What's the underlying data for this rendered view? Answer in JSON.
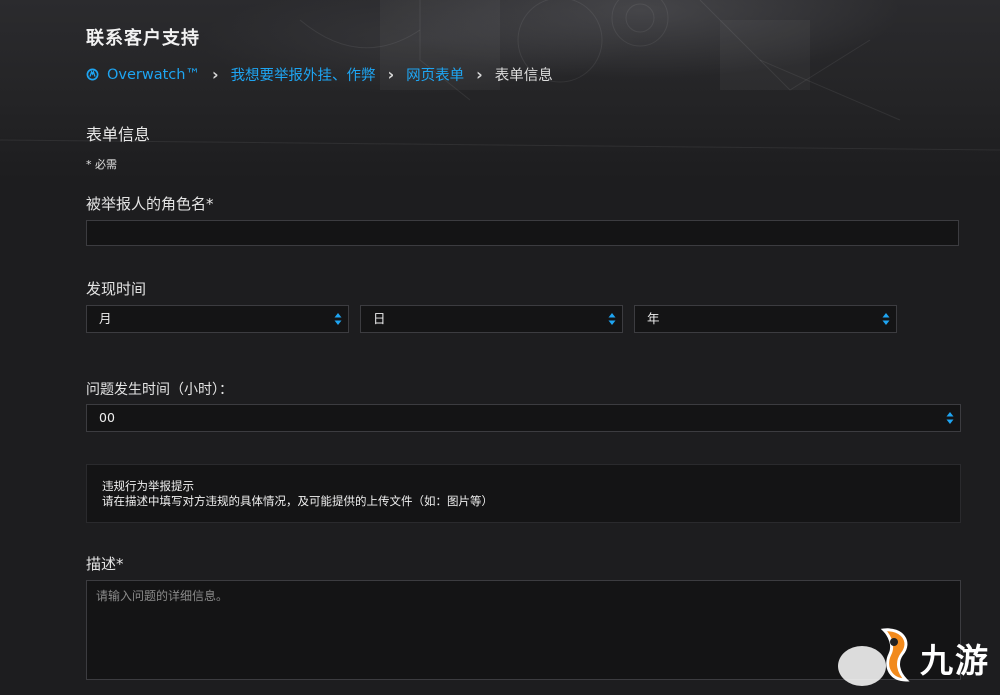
{
  "page": {
    "title": "联系客户支持"
  },
  "breadcrumb": {
    "items": [
      {
        "label": "Overwatch™",
        "icon": "overwatch-logo-icon"
      },
      {
        "label": "我想要举报外挂、作弊"
      },
      {
        "label": "网页表单"
      }
    ],
    "current": "表单信息"
  },
  "form": {
    "section_title": "表单信息",
    "required_note": "* 必需",
    "character_name": {
      "label": "被举报人的角色名*",
      "value": ""
    },
    "found_time": {
      "label": "发现时间",
      "month": "月",
      "day": "日",
      "year": "年"
    },
    "issue_hour": {
      "label": "问题发生时间（小时）：",
      "value": "00"
    },
    "notice": {
      "title": "违规行为举报提示",
      "body": "请在描述中填写对方违规的具体情况，及可能提供的上传文件（如：图片等）"
    },
    "description": {
      "label": "描述*",
      "placeholder": "请输入问题的详细信息。"
    }
  },
  "watermark": {
    "text": "九游"
  },
  "colors": {
    "link": "#1ea5f2",
    "background": "#1d1d1f",
    "field": "#141415"
  }
}
